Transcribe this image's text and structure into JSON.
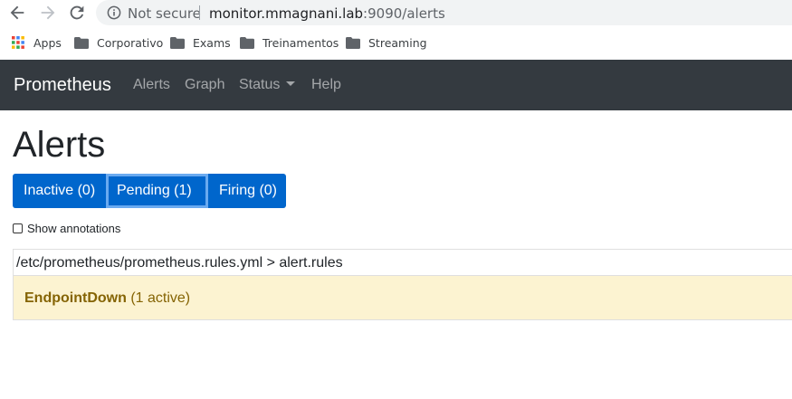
{
  "browser": {
    "security_label": "Not secure",
    "url_host": "monitor.mmagnani.lab",
    "url_rest": ":9090/alerts",
    "bookmarks": [
      {
        "label": "Apps",
        "icon": "apps-grid-icon"
      },
      {
        "label": "Corporativo",
        "icon": "folder-icon"
      },
      {
        "label": "Exams",
        "icon": "folder-icon"
      },
      {
        "label": "Treinamentos",
        "icon": "folder-icon"
      },
      {
        "label": "Streaming",
        "icon": "folder-icon"
      }
    ]
  },
  "navbar": {
    "brand": "Prometheus",
    "links": [
      "Alerts",
      "Graph",
      "Status",
      "Help"
    ]
  },
  "page": {
    "title": "Alerts",
    "filters": [
      "Inactive (0)",
      "Pending (1)",
      "Firing (0)"
    ],
    "show_annotations": "Show annotations",
    "rule_group": "/etc/prometheus/prometheus.rules.yml > alert.rules",
    "alerts": [
      {
        "name": "EndpointDown",
        "state": "(1 active)"
      }
    ]
  },
  "colors": {
    "navbar_bg": "#343a40",
    "button_blue": "#0066cc",
    "pending_highlight": "#6aaaf0",
    "alert_bg": "#fcf3d1",
    "alert_text": "#856404"
  }
}
